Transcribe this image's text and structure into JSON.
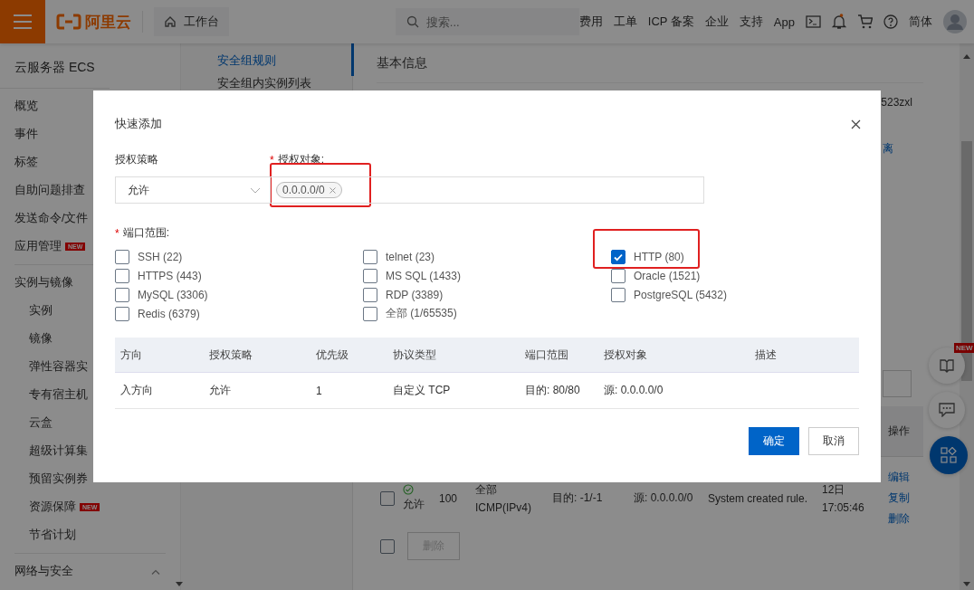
{
  "topbar": {
    "logo": "阿里云",
    "workbench": "工作台",
    "search": {
      "placeholder": "搜索..."
    },
    "links": [
      "费用",
      "工单",
      "ICP 备案",
      "企业",
      "支持",
      "App"
    ],
    "language": "简体"
  },
  "sidebar": {
    "title": "云服务器 ECS",
    "items": [
      {
        "label": "概览"
      },
      {
        "label": "事件"
      },
      {
        "label": "标签"
      },
      {
        "label": "自助问题排查"
      },
      {
        "label": "发送命令/文件"
      },
      {
        "label": "应用管理",
        "badge": "NEW"
      }
    ],
    "sections": [
      {
        "heading": "实例与镜像",
        "items": [
          {
            "label": "实例"
          },
          {
            "label": "镜像"
          },
          {
            "label": "弹性容器实"
          },
          {
            "label": "专有宿主机"
          },
          {
            "label": "云盒"
          },
          {
            "label": "超级计算集"
          },
          {
            "label": "预留实例券"
          },
          {
            "label": "资源保障",
            "badge": "NEW"
          },
          {
            "label": "节省计划"
          }
        ]
      },
      {
        "heading": "网络与安全"
      }
    ]
  },
  "subnav": [
    {
      "label": "安全组规则",
      "selected": true
    },
    {
      "label": "安全组内实例列表",
      "selected": false
    }
  ],
  "main": {
    "heading": "基本信息",
    "fragment": "523zxl",
    "link_fragment": "离",
    "rules": {
      "header": "操作",
      "rows": [
        {
          "checked": false,
          "policy": "允许",
          "priority": "100",
          "protocol": "全部",
          "protocol_detail": "ICMP(IPv4)",
          "port": "目的: -1/-1",
          "source": "源: 0.0.0.0/0",
          "description": "System created rule.",
          "date": "12日",
          "time": "17:05:46",
          "actions": [
            "编辑",
            "复制",
            "删除"
          ]
        }
      ]
    },
    "bulk": {
      "checked": false,
      "delete": {
        "label": "删除",
        "disabled": true
      }
    }
  },
  "floating": {
    "badge": "NEW"
  },
  "dialog": {
    "title": "快速添加",
    "policy": {
      "label": "授权策略",
      "value": "允许"
    },
    "target": {
      "label": "授权对象:",
      "required_mark": "*",
      "highlighted": true,
      "tags": [
        "0.0.0.0/0"
      ]
    },
    "ports": {
      "label": "端口范围:",
      "required_mark": "*",
      "columns": [
        {
          "options": [
            {
              "label": "SSH (22)",
              "checked": false,
              "highlighted": false
            },
            {
              "label": "HTTPS (443)",
              "checked": false,
              "highlighted": false
            },
            {
              "label": "MySQL (3306)",
              "checked": false,
              "highlighted": false
            },
            {
              "label": "Redis (6379)",
              "checked": false,
              "highlighted": false
            }
          ]
        },
        {
          "options": [
            {
              "label": "telnet (23)",
              "checked": false,
              "highlighted": false
            },
            {
              "label": "MS SQL (1433)",
              "checked": false,
              "highlighted": false
            },
            {
              "label": "RDP (3389)",
              "checked": false,
              "highlighted": false
            },
            {
              "label": "全部 (1/65535)",
              "checked": false,
              "highlighted": false
            }
          ]
        },
        {
          "options": [
            {
              "label": "HTTP (80)",
              "checked": true,
              "highlighted": true
            },
            {
              "label": "Oracle (1521)",
              "checked": false,
              "highlighted": false
            },
            {
              "label": "PostgreSQL (5432)",
              "checked": false,
              "highlighted": false
            }
          ]
        }
      ]
    },
    "table": {
      "columns": [
        "方向",
        "授权策略",
        "优先级",
        "协议类型",
        "端口范围",
        "授权对象",
        "描述"
      ],
      "rows": [
        {
          "cells": [
            "入方向",
            "允许",
            "1",
            "自定义 TCP",
            "目的: 80/80",
            "源: 0.0.0.0/0"
          ]
        }
      ]
    },
    "buttons": [
      {
        "label": "确定",
        "kind": "primary"
      },
      {
        "label": "取消",
        "kind": "default"
      }
    ]
  }
}
